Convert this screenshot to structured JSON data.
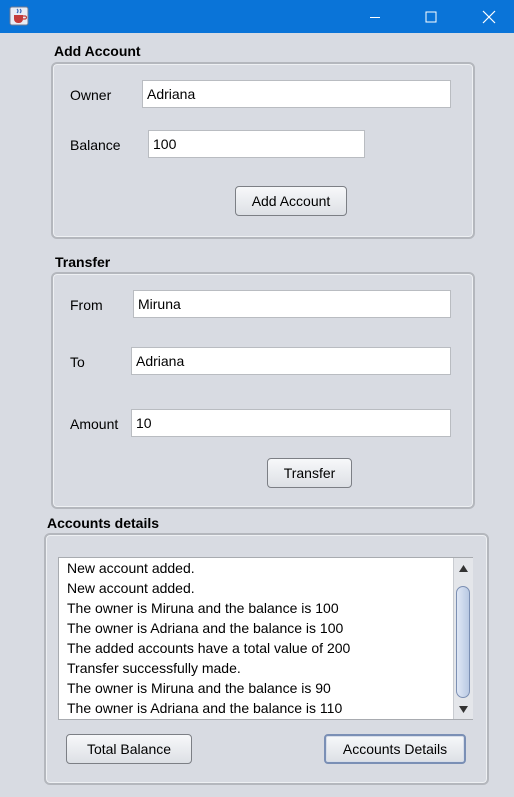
{
  "window": {
    "icons": {
      "app": "java-cup-icon",
      "minimize": "minimize-icon",
      "maximize": "maximize-icon",
      "close": "close-icon"
    },
    "titlebar_color": "#0a74d8"
  },
  "add_account": {
    "title": "Add Account",
    "owner_label": "Owner",
    "owner_value": "Adriana",
    "balance_label": "Balance",
    "balance_value": "100",
    "button_label": "Add Account"
  },
  "transfer": {
    "title": "Transfer",
    "from_label": "From",
    "from_value": "Miruna",
    "to_label": "To",
    "to_value": "Adriana",
    "amount_label": "Amount",
    "amount_value": "10",
    "button_label": "Transfer"
  },
  "details": {
    "title": "Accounts details",
    "log": [
      "New account added.",
      "New account added.",
      "The owner is Miruna and the balance is 100",
      "The owner is Adriana and the balance is 100",
      "The added accounts have a total value of 200",
      "Transfer successfully made.",
      "The owner is Miruna and the balance is 90",
      "The owner is Adriana and the balance is 110"
    ],
    "total_balance_label": "Total Balance",
    "accounts_details_label": "Accounts Details"
  }
}
